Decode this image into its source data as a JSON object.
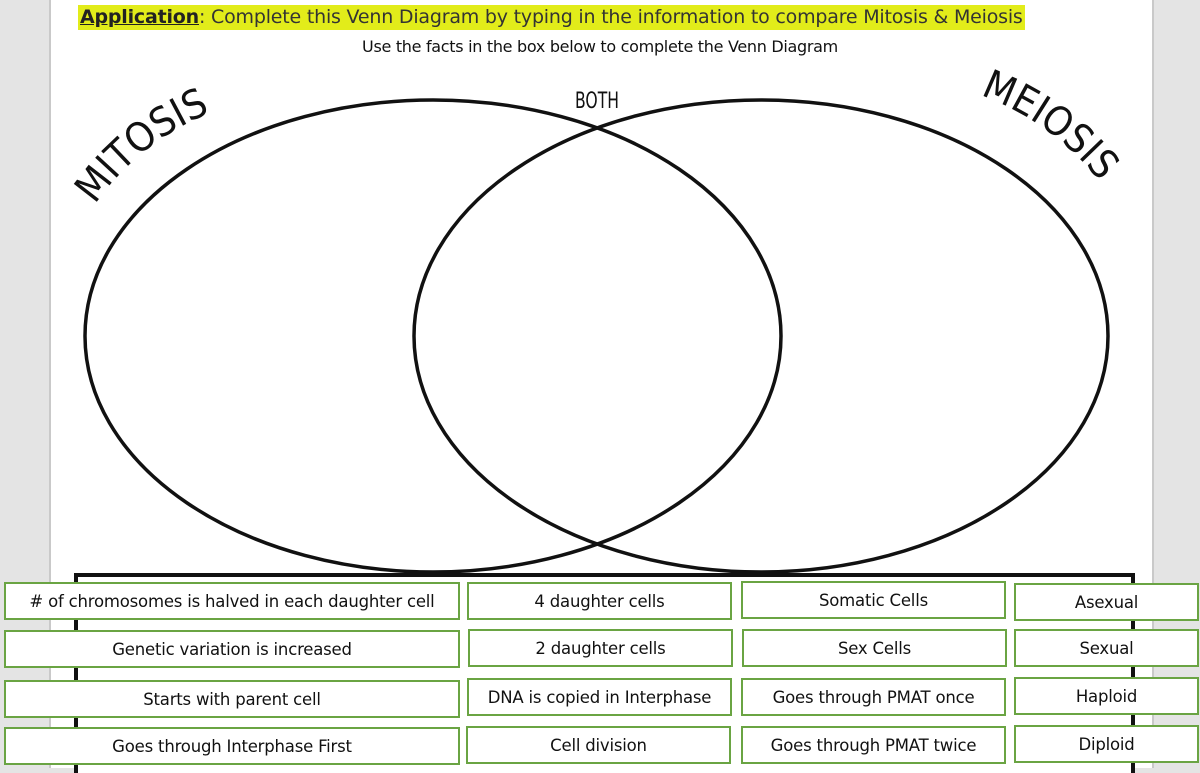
{
  "instruction": {
    "lead": "Application",
    "text": ": Complete this Venn Diagram by typing in the information to compare Mitosis & Meiosis",
    "highlight_color": "#e2ec1a"
  },
  "subtitle": "Use the facts in the box below to complete the Venn Diagram",
  "venn": {
    "left_label": "MITOSIS",
    "center_label": "BOTH",
    "right_label": "MEIOSIS"
  },
  "card_border_color": "#6aa443",
  "fact_cards": [
    [
      "# of chromosomes is halved in each daughter cell",
      "4 daughter cells",
      "Somatic Cells",
      "Asexual"
    ],
    [
      "Genetic variation is increased",
      "2 daughter cells",
      "Sex Cells",
      "Sexual"
    ],
    [
      "Starts with parent cell",
      "DNA is copied in Interphase",
      "Goes through PMAT once",
      "Haploid"
    ],
    [
      "Goes through Interphase First",
      "Cell division",
      "Goes through PMAT twice",
      "Diploid"
    ]
  ]
}
